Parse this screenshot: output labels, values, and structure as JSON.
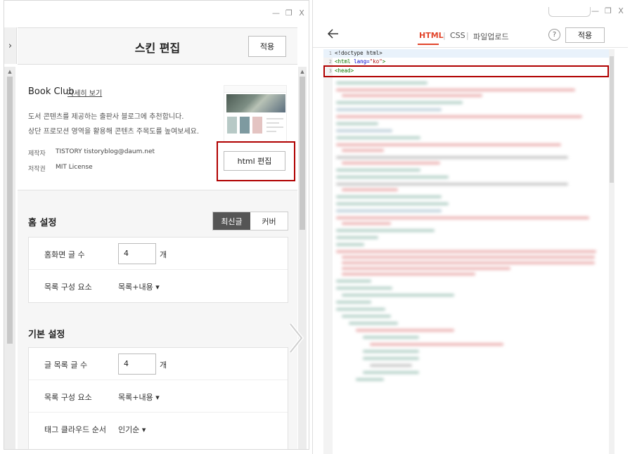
{
  "left_window": {
    "controls": {
      "minimize": "—",
      "restore": "❐",
      "close": "X"
    },
    "panel_toggle": "›",
    "header": {
      "title": "스킨 편집",
      "apply_label": "적용"
    },
    "skin_info": {
      "name": "Book Club",
      "detail_link": "자세히 보기",
      "description_line1": "도서 콘텐츠를 제공하는 출판사 블로그에 추천합니다.",
      "description_line2": "상단 프로모션 영역을 활용해 콘텐츠 주목도를 높여보세요.",
      "author_label": "제작자",
      "author_value": "TISTORY tistoryblog@daum.net",
      "license_label": "저작권",
      "license_value": "MIT License",
      "html_edit_label": "html 편집"
    },
    "home_settings": {
      "title": "홈 설정",
      "segment": [
        {
          "label": "최신글",
          "active": true
        },
        {
          "label": "커버",
          "active": false
        }
      ],
      "rows": [
        {
          "label": "홈화면 글 수",
          "value": "4",
          "unit": "개"
        },
        {
          "label": "목록 구성 요소",
          "select": "목록+내용 ▾"
        }
      ]
    },
    "basic_settings": {
      "title": "기본 설정",
      "rows": [
        {
          "label": "글 목록 글 수",
          "value": "4",
          "unit": "개"
        },
        {
          "label": "목록 구성 요소",
          "select": "목록+내용 ▾"
        },
        {
          "label": "태그 클라우드 순서",
          "select": "인기순 ▾"
        }
      ]
    }
  },
  "right_window": {
    "controls": {
      "minimize": "—",
      "restore": "❐",
      "close": "X"
    },
    "tabs": {
      "html": "HTML",
      "sep": "|",
      "css": "CSS",
      "upload": "파일업로드"
    },
    "help": "?",
    "apply_label": "적용",
    "code_lines": [
      {
        "num": "1",
        "text": "<!doctype html>"
      },
      {
        "num": "2",
        "tag_open": "<html",
        "attr": " lang=",
        "str": "\"ko\"",
        "tag_close": ">"
      },
      {
        "num": "3",
        "text": "<head>"
      }
    ]
  },
  "colors": {
    "accent": "#e2452b",
    "highlight_box": "#b00000",
    "segment_active": "#555555"
  }
}
